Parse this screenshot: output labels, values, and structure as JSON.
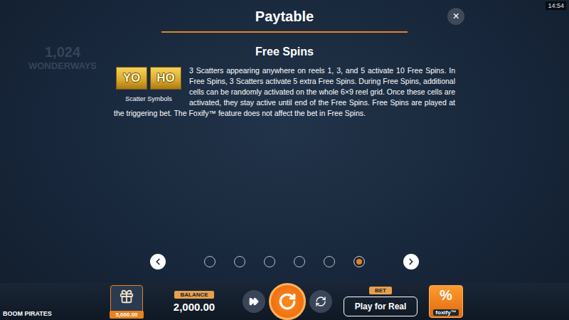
{
  "clock": "14:54",
  "header": {
    "title": "Paytable",
    "close": "×"
  },
  "background": {
    "ways": "1,024",
    "ways_label": "WONDERWAYS"
  },
  "section": {
    "title": "Free Spins",
    "symbols": [
      {
        "text": "YO"
      },
      {
        "text": "HO"
      }
    ],
    "caption": "Scatter Symbols",
    "body": "3 Scatters appearing anywhere on reels 1, 3, and 5 activate 10 Free Spins. In Free Spins, 3 Scatters activate 5 extra Free Spins. During Free Spins, additional cells can be randomly activated on the whole 6×9 reel grid. Once these cells are activated, they stay active until end of the Free Spins. Free Spins are played at the triggering bet. The Foxify™ feature does not affect the bet in Free Spins."
  },
  "pagination": {
    "pages": [
      {
        "selected": false
      },
      {
        "selected": false
      },
      {
        "selected": false
      },
      {
        "selected": false
      },
      {
        "selected": false
      },
      {
        "selected": true
      }
    ]
  },
  "bottom_bar": {
    "game_name": "BOOM PIRATES",
    "gift": {
      "amount": "5,000.00"
    },
    "balance": {
      "label": "BALANCE",
      "value": "2,000.00"
    },
    "bet": {
      "label": "BET",
      "button": "Play for Real"
    },
    "foxify": {
      "symbol": "%",
      "label": "foxify™"
    }
  }
}
